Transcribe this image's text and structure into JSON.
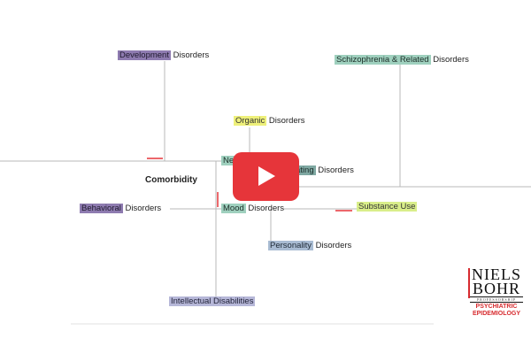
{
  "nodes": {
    "development": {
      "hl": "Development",
      "rest": " Disorders"
    },
    "schizophrenia": {
      "hl": "Schizophrenia & Related",
      "rest": " Disorders"
    },
    "organic": {
      "hl": "Organic",
      "rest": " Disorders"
    },
    "neuro": {
      "hl": "Ne",
      "rest": ""
    },
    "eating": {
      "hl": "ating",
      "rest": " Disorders"
    },
    "comorbidity": "Comorbidity",
    "behavioral": {
      "hl": "Behavioral",
      "rest": " Disorders"
    },
    "mood": {
      "hl": "Mood",
      "rest": " Disorders"
    },
    "substance": {
      "hl": "Substance Use",
      "rest": ""
    },
    "personality": {
      "hl": "Personality",
      "rest": " Disorders"
    },
    "intellectual": {
      "hl": "Intellectual Disabilities",
      "rest": ""
    }
  },
  "logo": {
    "line1": "NIELS",
    "line2": "BOHR",
    "line3": "PROFESSORSHIP",
    "line4": "PSYCHIATRIC",
    "line5": "EPIDEMIOLOGY"
  },
  "video": {
    "play_icon": "play-icon",
    "color": "#e6353a"
  }
}
